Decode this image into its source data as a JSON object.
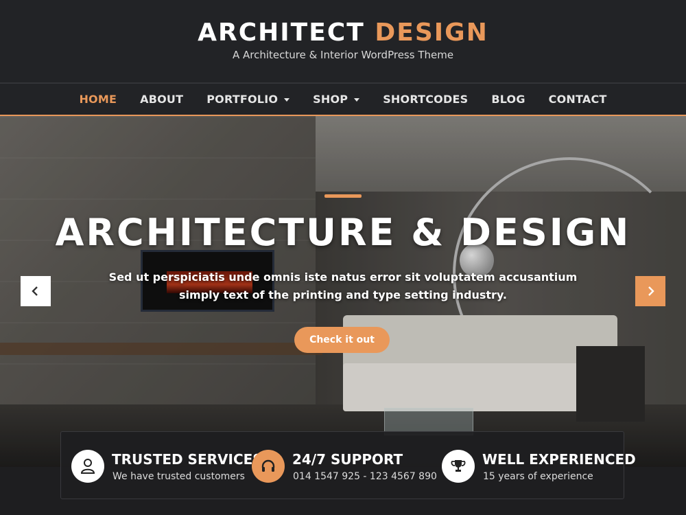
{
  "site": {
    "title_part1": "ARCHITECT",
    "title_part2": "DESIGN",
    "tagline": "A Architecture & Interior WordPress Theme"
  },
  "nav": {
    "items": [
      {
        "label": "HOME",
        "active": true,
        "has_dropdown": false
      },
      {
        "label": "ABOUT",
        "active": false,
        "has_dropdown": false
      },
      {
        "label": "PORTFOLIO",
        "active": false,
        "has_dropdown": true
      },
      {
        "label": "SHOP",
        "active": false,
        "has_dropdown": true
      },
      {
        "label": "SHORTCODES",
        "active": false,
        "has_dropdown": false
      },
      {
        "label": "BLOG",
        "active": false,
        "has_dropdown": false
      },
      {
        "label": "CONTACT",
        "active": false,
        "has_dropdown": false
      }
    ]
  },
  "hero": {
    "title": "ARCHITECTURE & DESIGN",
    "text": "Sed ut perspiciatis unde omnis iste natus error sit voluptatem accusantium simply text of the printing and type setting industry.",
    "button_label": "Check it out",
    "prev_icon": "chevron-left-icon",
    "next_icon": "chevron-right-icon"
  },
  "features": [
    {
      "icon": "user-icon",
      "title": "TRUSTED SERVICES",
      "subtitle": "We have trusted customers"
    },
    {
      "icon": "headset-icon",
      "title": "24/7 SUPPORT",
      "subtitle": "014 1547 925 - 123 4567 890"
    },
    {
      "icon": "trophy-icon",
      "title": "WELL EXPERIENCED",
      "subtitle": "15 years of experience"
    }
  ],
  "colors": {
    "accent": "#e9985a",
    "header_bg": "#222326",
    "text_light": "#ffffff"
  }
}
